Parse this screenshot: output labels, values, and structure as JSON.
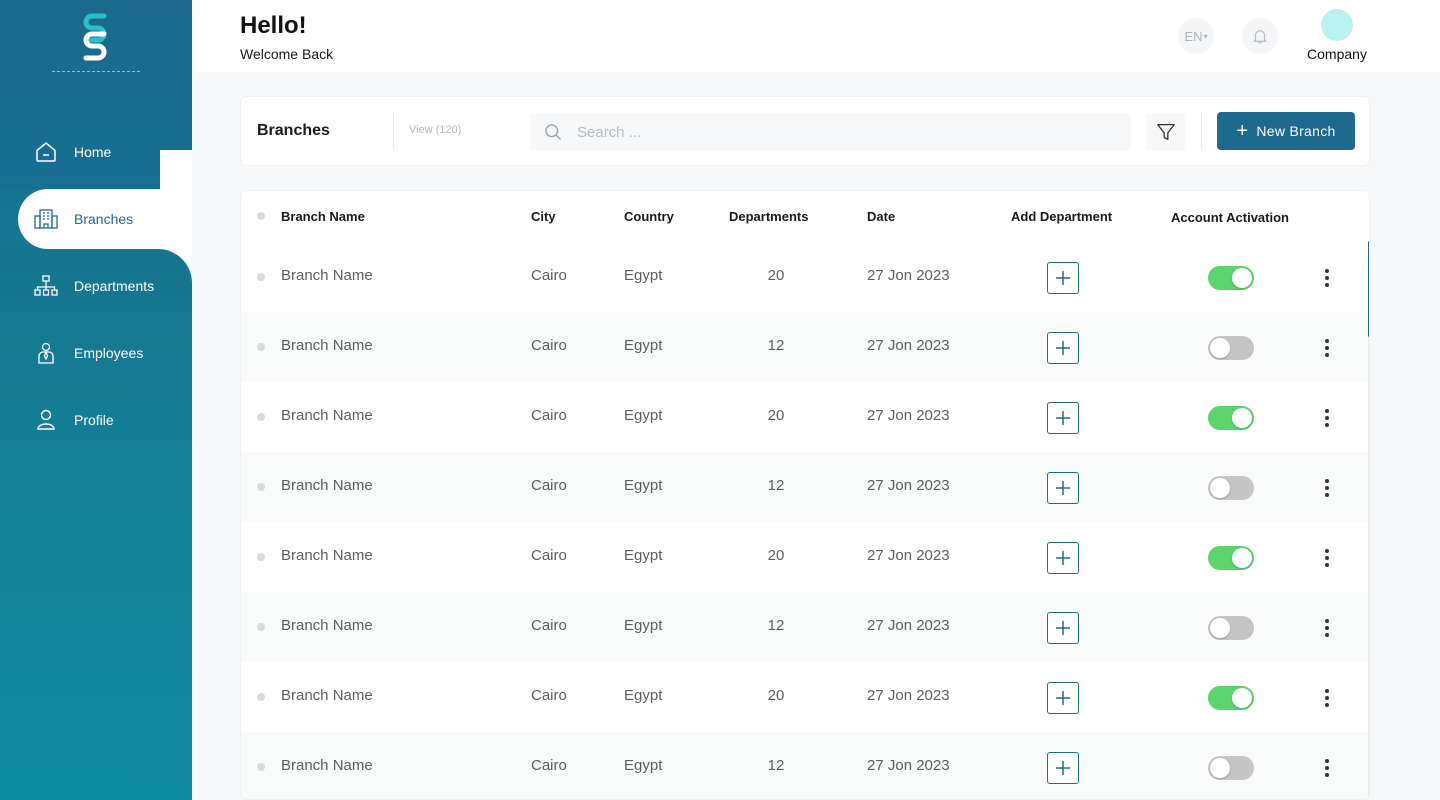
{
  "header": {
    "greeting": "Hello!",
    "subtitle": "Welcome Back",
    "language": "EN",
    "company_name": "Company"
  },
  "sidebar": {
    "items": [
      {
        "label": "Home",
        "icon": "home-icon"
      },
      {
        "label": "Branches",
        "icon": "building-icon",
        "active": true
      },
      {
        "label": "Departments",
        "icon": "org-chart-icon"
      },
      {
        "label": "Employees",
        "icon": "employee-icon"
      },
      {
        "label": "Profile",
        "icon": "user-icon"
      }
    ]
  },
  "toolbar": {
    "title": "Branches",
    "view_count": "View (120)",
    "search_placeholder": "Search ...",
    "new_button": "New Branch"
  },
  "table": {
    "headers": {
      "name": "Branch Name",
      "city": "City",
      "country": "Country",
      "departments": "Departments",
      "date": "Date",
      "add": "Add Department",
      "activation": "Account Activation"
    },
    "rows": [
      {
        "name": "Branch Name",
        "city": "Cairo",
        "country": "Egypt",
        "departments": "20",
        "date": "27 Jon 2023",
        "active": true
      },
      {
        "name": "Branch Name",
        "city": "Cairo",
        "country": "Egypt",
        "departments": "12",
        "date": "27 Jon 2023",
        "active": false
      },
      {
        "name": "Branch Name",
        "city": "Cairo",
        "country": "Egypt",
        "departments": "20",
        "date": "27 Jon 2023",
        "active": true
      },
      {
        "name": "Branch Name",
        "city": "Cairo",
        "country": "Egypt",
        "departments": "12",
        "date": "27 Jon 2023",
        "active": false
      },
      {
        "name": "Branch Name",
        "city": "Cairo",
        "country": "Egypt",
        "departments": "20",
        "date": "27 Jon 2023",
        "active": true
      },
      {
        "name": "Branch Name",
        "city": "Cairo",
        "country": "Egypt",
        "departments": "12",
        "date": "27 Jon 2023",
        "active": false
      },
      {
        "name": "Branch Name",
        "city": "Cairo",
        "country": "Egypt",
        "departments": "20",
        "date": "27 Jon 2023",
        "active": true
      },
      {
        "name": "Branch Name",
        "city": "Cairo",
        "country": "Egypt",
        "departments": "12",
        "date": "27 Jon 2023",
        "active": false
      }
    ]
  },
  "colors": {
    "primary": "#1d6a8e",
    "toggle_on": "#5bd46b",
    "toggle_off": "#c5c5c5",
    "avatar": "#b8f3ee"
  }
}
